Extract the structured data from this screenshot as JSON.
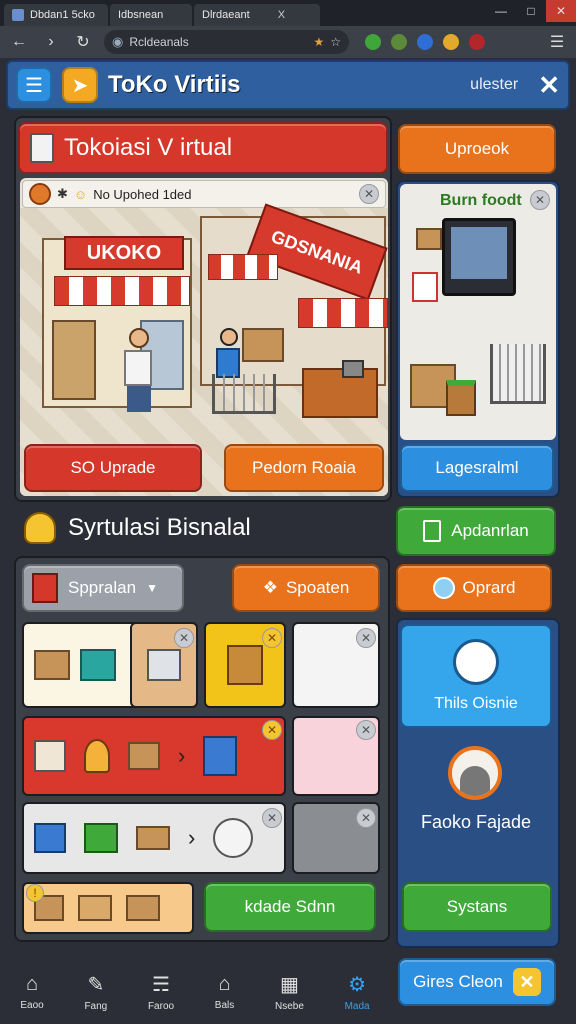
{
  "browser": {
    "tabs": [
      {
        "label": "Dbdan1 5cko"
      },
      {
        "label": "Idbsnean"
      },
      {
        "label": "Dlrdaeant"
      }
    ],
    "tab_close": "X",
    "address": "Rcldeanals",
    "window_buttons": {
      "min": "—",
      "max": "□",
      "close": "✕"
    }
  },
  "app": {
    "title": "ToKo Virtiis",
    "user_label": "ulester",
    "close_glyph": "✕"
  },
  "store_header": {
    "title": "Tokoiasi V irtual"
  },
  "side_top_button": "Uproeok",
  "scene_caption": "No Upohed 1ded",
  "shop_sign_left": "UKOKO",
  "shop_sign_right": "GDSNANIA",
  "scene_buttons": {
    "left": "SO Uprade",
    "right": "Pedorn Roaia"
  },
  "side_card": {
    "title": "Burn foodt",
    "button": "Lagesralml"
  },
  "sim_title": "Syrtulasi Bisnalal",
  "side_apply_button": "Apdanrlan",
  "toolbar": {
    "dropdown": "Sppralan",
    "action": "Spoaten"
  },
  "side_upgrade_button": "Oprard",
  "side_blue_card": {
    "label": "Thils Oisnie"
  },
  "side_profile": {
    "label": "Faoko Fajade"
  },
  "bottom_green_button": "kdade Sdnn",
  "side_systems_button": "Systans",
  "side_bottom_button": "Gires Cleon",
  "bottom_nav": [
    {
      "label": "Eaoo",
      "icon": "home-icon"
    },
    {
      "label": "Fang",
      "icon": "edit-icon"
    },
    {
      "label": "Faroo",
      "icon": "cart-icon"
    },
    {
      "label": "Bals",
      "icon": "store-icon"
    },
    {
      "label": "Nsebe",
      "icon": "grid-icon"
    },
    {
      "label": "Mada",
      "icon": "gear-icon"
    }
  ],
  "colors": {
    "accent_blue": "#2d8fe0",
    "accent_orange": "#e8731c",
    "accent_red": "#d6372b",
    "accent_green": "#3faa3a",
    "app_bar": "#2f5f9e"
  }
}
